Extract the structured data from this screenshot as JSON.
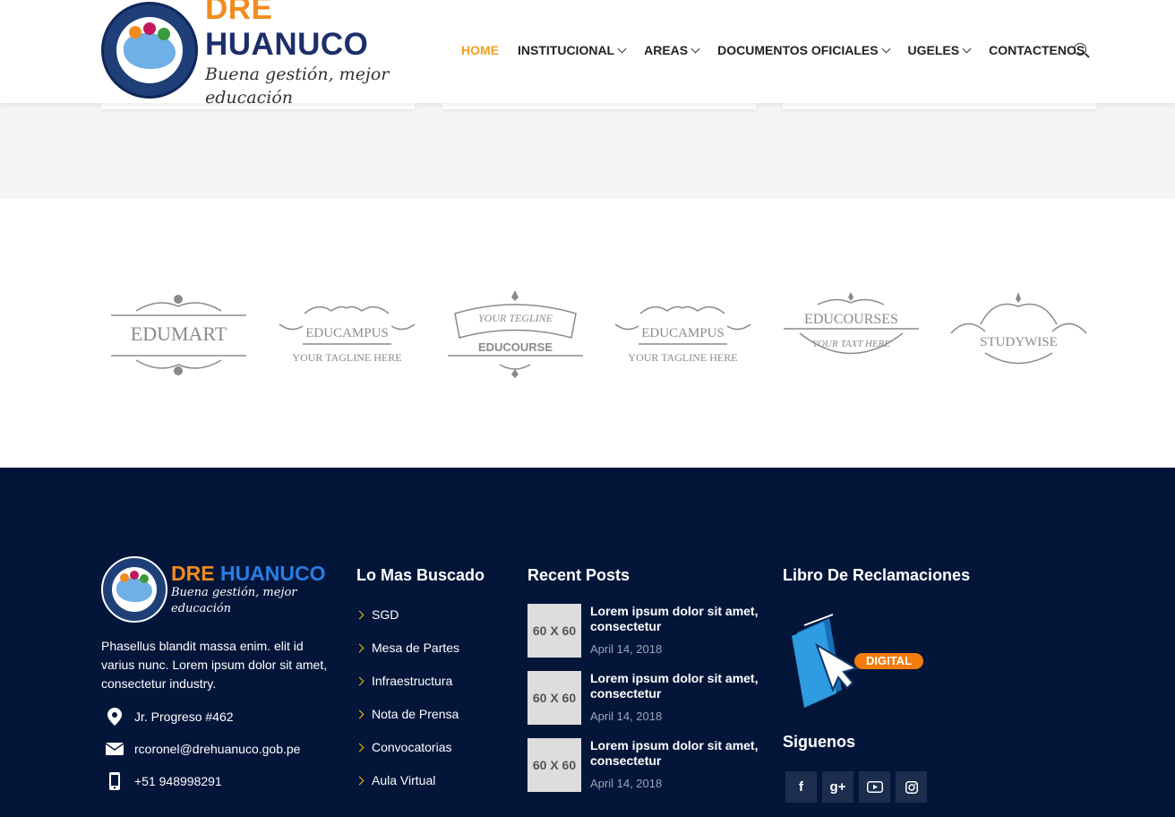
{
  "header": {
    "logo": {
      "title_part1": "DRE",
      "title_part2": "HUANUCO",
      "tagline": "Buena gestión, mejor educación"
    },
    "nav": [
      {
        "label": "HOME",
        "active": true,
        "dropdown": false
      },
      {
        "label": "INSTITUCIONAL",
        "active": false,
        "dropdown": true
      },
      {
        "label": "AREAS",
        "active": false,
        "dropdown": true
      },
      {
        "label": "DOCUMENTOS OFICIALES",
        "active": false,
        "dropdown": true
      },
      {
        "label": "UGELES",
        "active": false,
        "dropdown": true
      },
      {
        "label": "CONTACTENOS",
        "active": false,
        "dropdown": false
      }
    ],
    "search_icon": "search-icon",
    "accent_color": "#f0a020"
  },
  "partners": [
    {
      "name": "EDUMART",
      "tagline": ""
    },
    {
      "name": "EDUCAMPUS",
      "tagline": "YOUR TAGLINE HERE"
    },
    {
      "name": "EDUCOURSE",
      "tagline": "YOUR TEGLINE"
    },
    {
      "name": "EDUCAMPUS",
      "tagline": "YOUR TAGLINE HERE"
    },
    {
      "name": "EDUCOURSES",
      "tagline": "YOUR TAXT HERE"
    },
    {
      "name": "STUDYWISE",
      "tagline": ""
    }
  ],
  "footer": {
    "background": "#03163a",
    "logo": {
      "title_part1": "DRE",
      "title_part2": "HUANUCO",
      "tagline": "Buena gestión, mejor educación"
    },
    "description": "Phasellus blandit massa enim. elit id varius nunc. Lorem ipsum dolor sit amet, consectetur industry.",
    "contact": {
      "address": "Jr. Progreso #462",
      "email": "rcoronel@drehuanuco.gob.pe",
      "phone": "+51 948998291"
    },
    "links_title": "Lo Mas Buscado",
    "links": [
      "SGD",
      "Mesa de Partes",
      "Infraestructura",
      "Nota de Prensa",
      "Convocatorias",
      "Aula Virtual"
    ],
    "posts_title": "Recent Posts",
    "posts": [
      {
        "thumb": "60 X 60",
        "title": "Lorem ipsum dolor sit amet, consectetur",
        "date": "April 14, 2018"
      },
      {
        "thumb": "60 X 60",
        "title": "Lorem ipsum dolor sit amet, consectetur",
        "date": "April 14, 2018"
      },
      {
        "thumb": "60 X 60",
        "title": "Lorem ipsum dolor sit amet, consectetur",
        "date": "April 14, 2018"
      }
    ],
    "libro_title": "Libro De Reclamaciones",
    "libro_badge": "DIGITAL",
    "social_title": "Siguenos",
    "social": [
      {
        "icon": "facebook-icon",
        "glyph": "f"
      },
      {
        "icon": "google-plus-icon",
        "glyph": "g+"
      },
      {
        "icon": "youtube-icon",
        "glyph": ""
      },
      {
        "icon": "instagram-icon",
        "glyph": ""
      }
    ]
  }
}
